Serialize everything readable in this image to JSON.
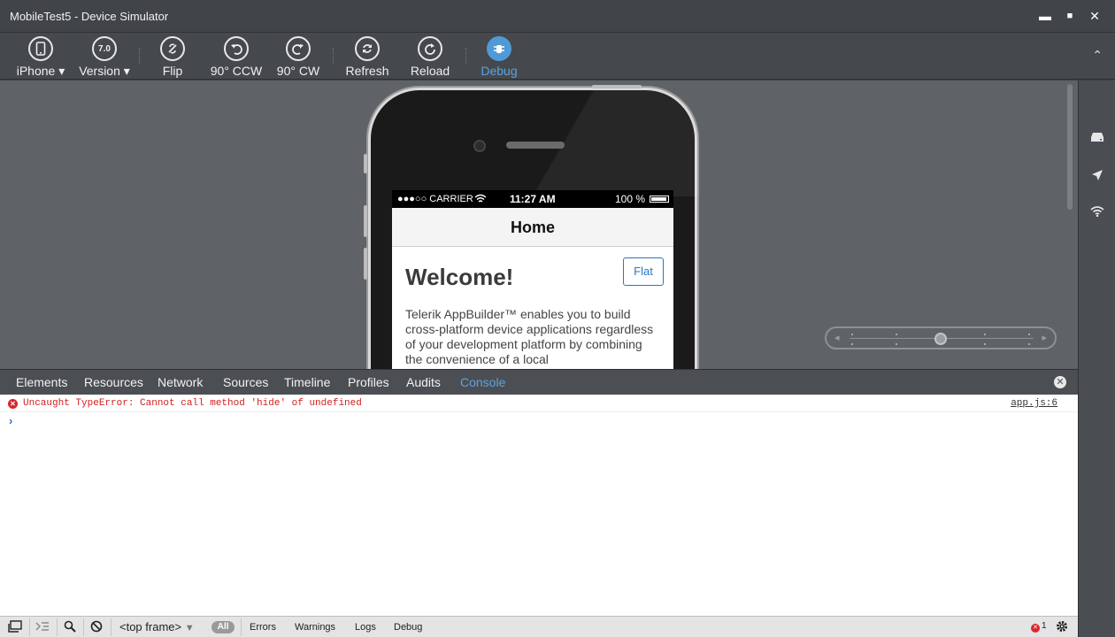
{
  "window": {
    "title": "MobileTest5 - Device Simulator",
    "minimize": "▬",
    "maximize": "■",
    "close": "✕"
  },
  "toolbar": {
    "device_label": "iPhone ▾",
    "version_badge": "7.0",
    "version_label": "Version ▾",
    "flip_label": "Flip",
    "ccw_label": "90° CCW",
    "cw_label": "90° CW",
    "refresh_label": "Refresh",
    "reload_label": "Reload",
    "debug_label": "Debug",
    "collapse": "⌃"
  },
  "phone": {
    "statusbar": {
      "carrier": "●●●○○ CARRIER",
      "time": "11:27 AM",
      "battery": "100 %"
    },
    "nav_title": "Home",
    "heading": "Welcome!",
    "flat_button": "Flat",
    "description": "Telerik AppBuilder™ enables you to build cross-platform device applications regardless of your development platform by combining the convenience of a local"
  },
  "devtools": {
    "tabs": [
      "Elements",
      "Resources",
      "Network",
      "Sources",
      "Timeline",
      "Profiles",
      "Audits",
      "Console"
    ],
    "active_tab": "Console",
    "console": {
      "error_message": "Uncaught TypeError: Cannot call method 'hide' of undefined",
      "error_source": "app.js:6",
      "prompt": "›"
    },
    "bottom": {
      "frame": "<top frame>",
      "all": "All",
      "filters": [
        "Errors",
        "Warnings",
        "Logs",
        "Debug"
      ],
      "error_count": "1"
    }
  },
  "icons": [
    "phone-icon",
    "version-icon",
    "flip-icon",
    "rotate-ccw-icon",
    "rotate-cw-icon",
    "refresh-icon",
    "reload-icon",
    "debug-icon",
    "storage-icon",
    "location-icon",
    "wifi-icon",
    "settings-icon"
  ]
}
